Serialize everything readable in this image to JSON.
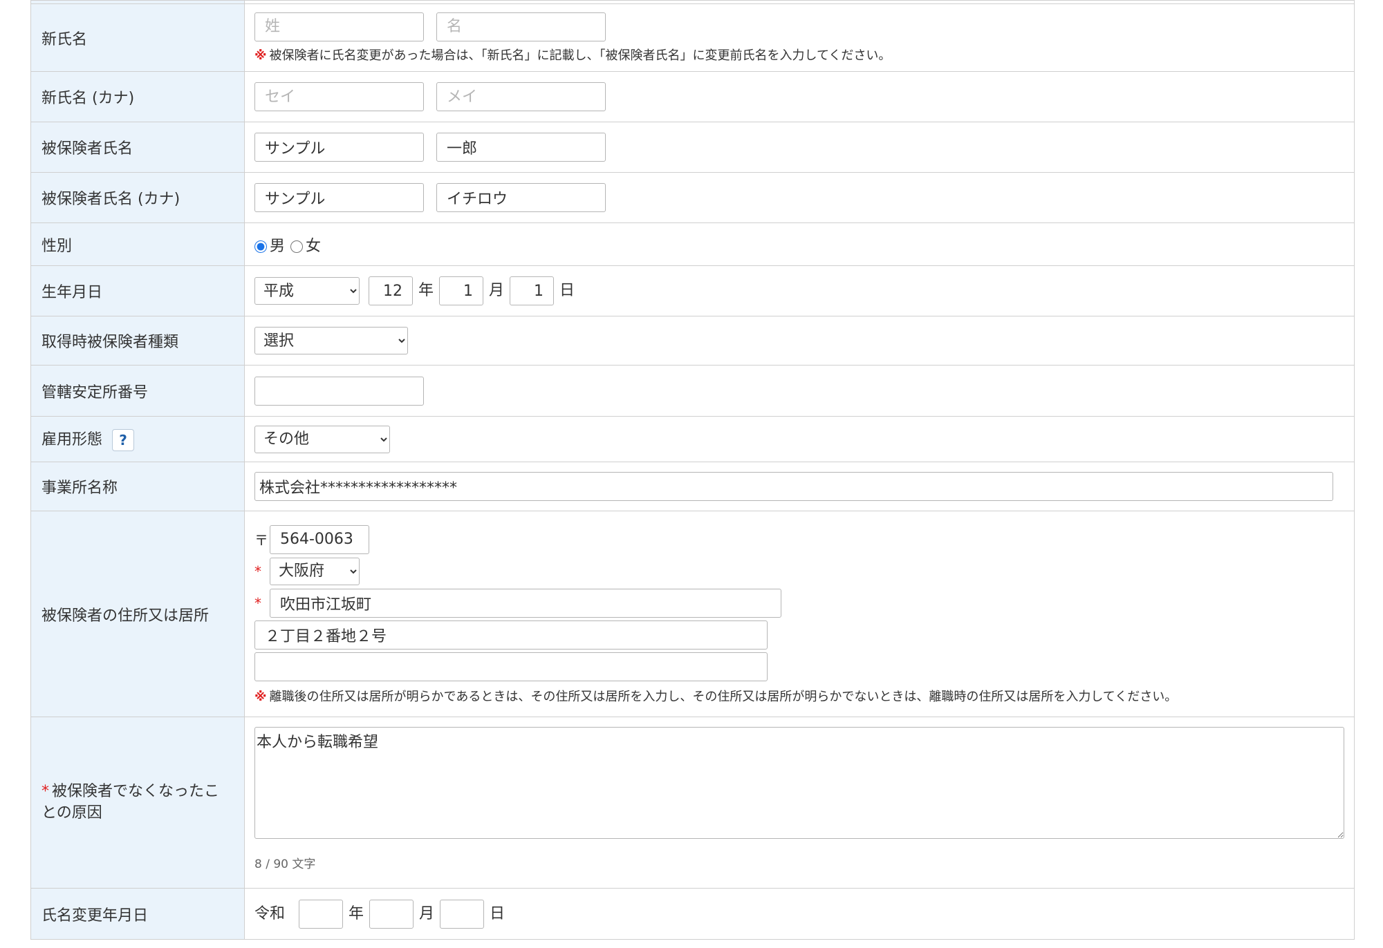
{
  "rows": {
    "new_name": {
      "label": "新氏名",
      "last_placeholder": "姓",
      "first_placeholder": "名",
      "note_mark": "※",
      "note": "被保険者に氏名変更があった場合は、「新氏名」に記載し、「被保険者氏名」に変更前氏名を入力してください。"
    },
    "new_name_kana": {
      "label": "新氏名 (カナ)",
      "last_placeholder": "セイ",
      "first_placeholder": "メイ"
    },
    "insured_name": {
      "label": "被保険者氏名",
      "last_value": "サンプル",
      "first_value": "一郎"
    },
    "insured_name_kana": {
      "label": "被保険者氏名 (カナ)",
      "last_value": "サンプル",
      "first_value": "イチロウ"
    },
    "gender": {
      "label": "性別",
      "options": [
        "男",
        "女"
      ],
      "selected": "男"
    },
    "birth_date": {
      "label": "生年月日",
      "era": "平成",
      "year": "12",
      "month": "1",
      "day": "1",
      "year_unit": "年",
      "month_unit": "月",
      "day_unit": "日"
    },
    "insured_type": {
      "label": "取得時被保険者種類",
      "selected": "選択"
    },
    "office_number": {
      "label": "管轄安定所番号",
      "value": ""
    },
    "employment_type": {
      "label": "雇用形態",
      "help": "?",
      "selected": "その他"
    },
    "business_name": {
      "label": "事業所名称",
      "value": "株式会社******************"
    },
    "address": {
      "label": "被保険者の住所又は居所",
      "zip_mark": "〒",
      "zip": "564-0063",
      "required_mark": "*",
      "prefecture": "大阪府",
      "city": "吹田市江坂町",
      "line1": "２丁目２番地２号",
      "line2": "",
      "note_mark": "※",
      "note": "離職後の住所又は居所が明らかであるときは、その住所又は居所を入力し、その住所又は居所が明らかでないときは、離職時の住所又は居所を入力してください。"
    },
    "reason": {
      "required_mark": "*",
      "label": "被保険者でなくなったことの原因",
      "value": "本人から転職希望",
      "counter": "8 / 90 文字"
    },
    "name_change_date": {
      "label": "氏名変更年月日",
      "era": "令和",
      "year": "",
      "month": "",
      "day": "",
      "year_unit": "年",
      "month_unit": "月",
      "day_unit": "日"
    }
  },
  "colors": {
    "label_bg": "#eaf3fb",
    "border": "#cfcfcf",
    "required": "#e02020",
    "radio_accent": "#1a73e8"
  }
}
